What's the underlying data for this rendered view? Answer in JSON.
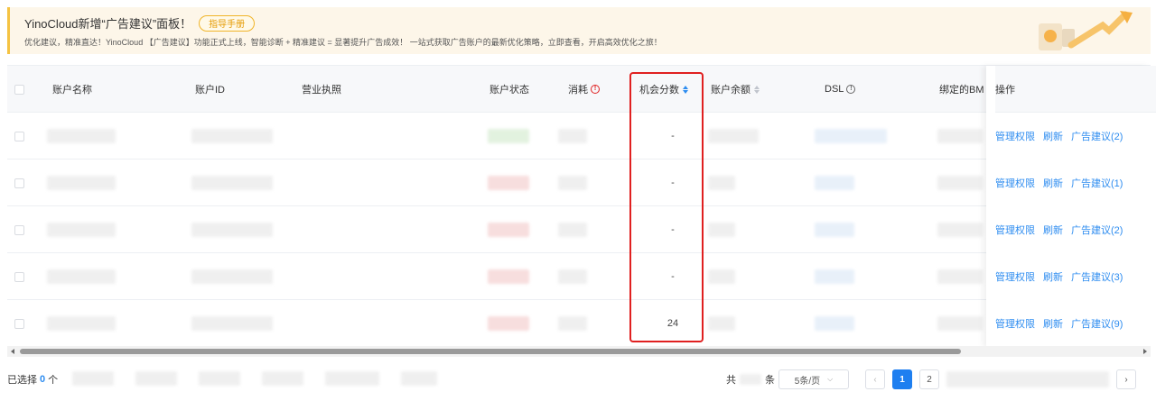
{
  "banner": {
    "title": "YinoCloud新增“广告建议”面板！",
    "guide_button": "指导手册",
    "description": "优化建议，精准直达！YinoCloud 【广告建议】功能正式上线，智能诊断 + 精准建议 = 显著提升广告成效！ 一站式获取广告账户的最新优化策略，立即查看，开启高效优化之旅！"
  },
  "table": {
    "headers": {
      "account_name": "账户名称",
      "account_id": "账户ID",
      "license": "营业执照",
      "status": "账户状态",
      "spend": "消耗",
      "opportunity_score": "机会分数",
      "balance": "账户余额",
      "dsl": "DSL",
      "bound_bm": "绑定的BM",
      "actions": "操作"
    },
    "rows": [
      {
        "opportunity_score": "-",
        "manage": "管理权限",
        "refresh": "刷新",
        "suggestion": "广告建议(2)"
      },
      {
        "opportunity_score": "-",
        "manage": "管理权限",
        "refresh": "刷新",
        "suggestion": "广告建议(1)"
      },
      {
        "opportunity_score": "-",
        "manage": "管理权限",
        "refresh": "刷新",
        "suggestion": "广告建议(2)"
      },
      {
        "opportunity_score": "-",
        "manage": "管理权限",
        "refresh": "刷新",
        "suggestion": "广告建议(3)"
      },
      {
        "opportunity_score": "24",
        "manage": "管理权限",
        "refresh": "刷新",
        "suggestion": "广告建议(9)"
      }
    ]
  },
  "footer": {
    "selected_prefix": "已选择",
    "selected_count": "0",
    "selected_suffix": "个",
    "total_prefix": "共",
    "total_suffix": "条",
    "page_size": "5条/页",
    "pages": [
      "1",
      "2"
    ],
    "current_page": "1"
  },
  "colors": {
    "accent": "#2d8cf0",
    "highlight": "#e02020",
    "banner_bg": "#fdf6e9"
  }
}
